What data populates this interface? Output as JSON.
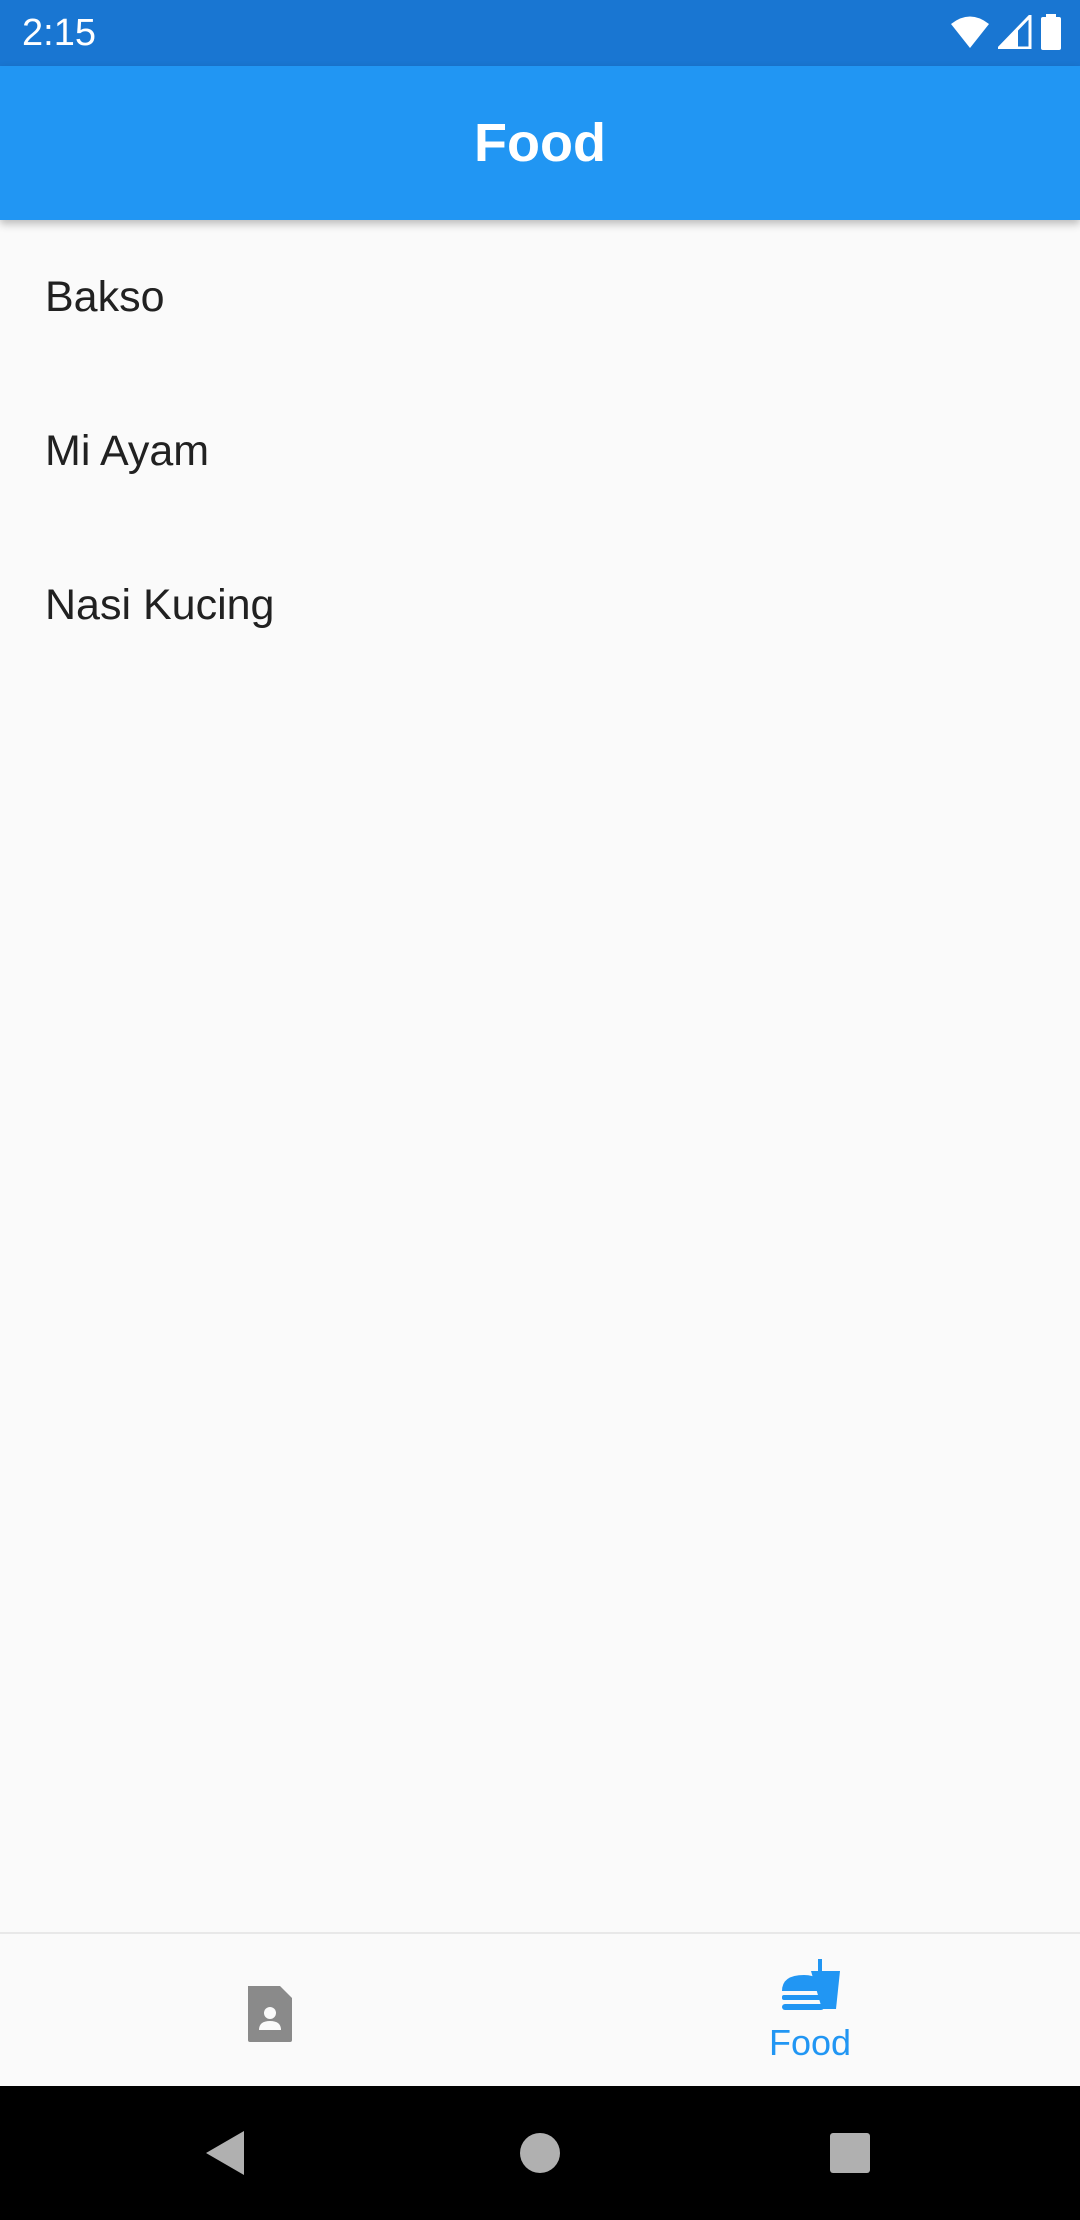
{
  "status_bar": {
    "time": "2:15",
    "icons": [
      "wifi-icon",
      "cellular-signal-icon",
      "battery-icon"
    ]
  },
  "app_bar": {
    "title": "Food"
  },
  "food_list": [
    {
      "label": "Bakso"
    },
    {
      "label": "Mi Ayam"
    },
    {
      "label": "Nasi Kucing"
    }
  ],
  "bottom_nav": {
    "items": [
      {
        "icon": "contact-card-icon",
        "label": "",
        "selected": false
      },
      {
        "icon": "fastfood-icon",
        "label": "Food",
        "selected": true
      }
    ]
  },
  "system_nav": {
    "buttons": [
      "back-icon",
      "home-icon",
      "recents-icon"
    ]
  },
  "colors": {
    "status_bar": "#1976D2",
    "app_bar": "#2196F3",
    "accent": "#2196F3",
    "background": "#FAFAFA",
    "inactive_icon": "#8A8A8A",
    "system_nav": "#000000"
  }
}
